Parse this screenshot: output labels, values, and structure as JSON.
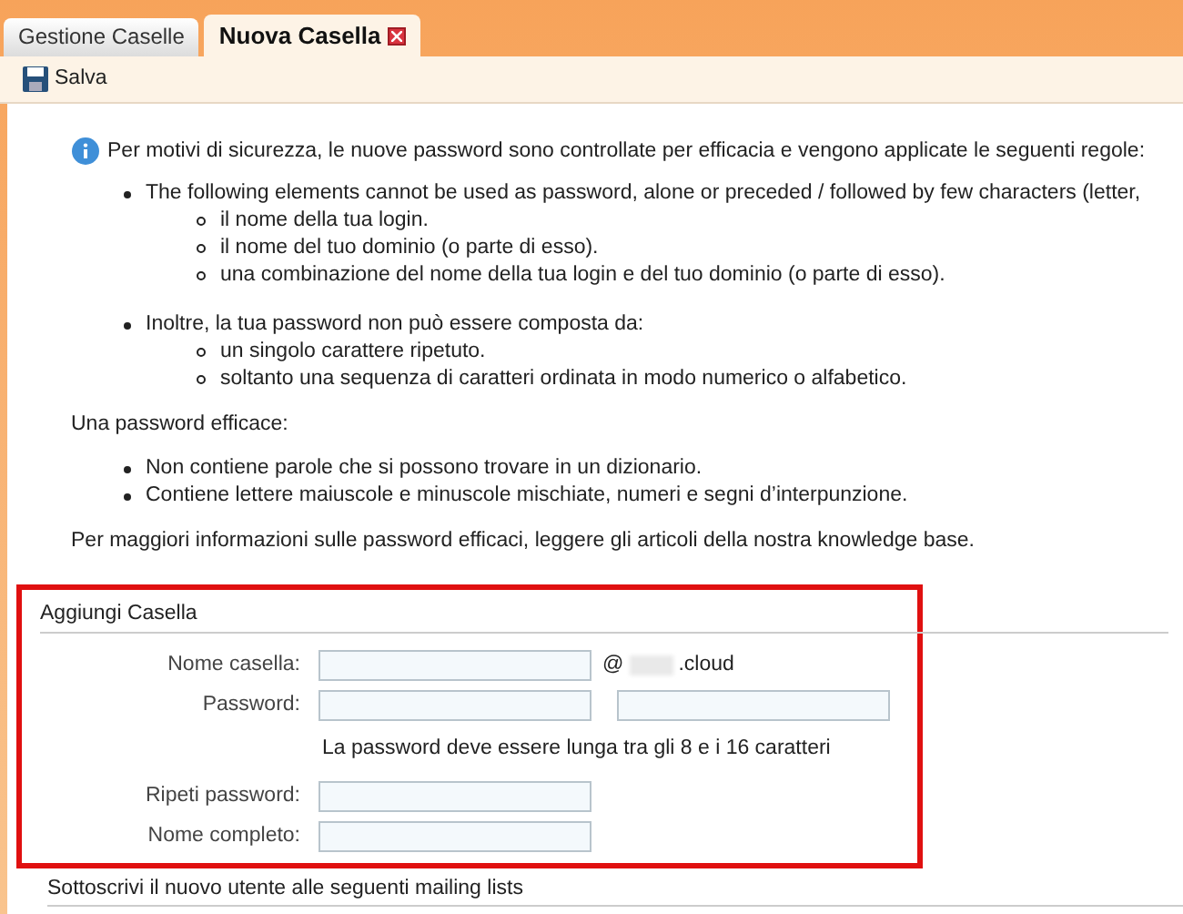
{
  "tabs": [
    {
      "label": "Gestione Caselle",
      "selected": false,
      "closable": false
    },
    {
      "label": "Nuova Casella",
      "selected": true,
      "closable": true
    }
  ],
  "toolbar": {
    "save_label": "Salva"
  },
  "info": {
    "intro": "Per motivi di sicurezza, le nuove password sono controllate per efficacia e vengono applicate le seguenti regole:",
    "rules": [
      {
        "text": "The following elements cannot be used as password, alone or preceded / followed by few characters (letter,",
        "children": [
          "il nome della tua login.",
          "il nome del tuo dominio (o parte di esso).",
          "una combinazione del nome della tua login e del tuo dominio (o parte di esso)."
        ]
      },
      {
        "text": "Inoltre, la tua password non può essere composta da:",
        "children": [
          "un singolo carattere ripetuto.",
          "soltanto una sequenza di caratteri ordinata in modo numerico o alfabetico."
        ]
      }
    ],
    "good_title": "Una password efficace:",
    "good_items": [
      "Non contiene parole che si possono trovare in un dizionario.",
      "Contiene lettere maiuscole e minuscole mischiate, numeri e segni d’interpunzione."
    ],
    "more": "Per maggiori informazioni sulle password efficaci, leggere gli articoli della nostra knowledge base."
  },
  "form": {
    "title": "Aggiungi Casella",
    "highlighted": true,
    "rows": [
      {
        "kind": "email",
        "label": "Nome casella:",
        "at": "@",
        "domain": ".cloud"
      },
      {
        "kind": "password",
        "label": "Password:"
      },
      {
        "kind": "hint",
        "text": "La password deve essere lunga tra gli 8 e i 16 caratteri"
      },
      {
        "kind": "text",
        "label": "Ripeti password:"
      },
      {
        "kind": "text",
        "label": "Nome completo:"
      }
    ]
  },
  "mailing_section": {
    "title": "Sottoscrivi il nuovo utente alle seguenti mailing lists"
  }
}
